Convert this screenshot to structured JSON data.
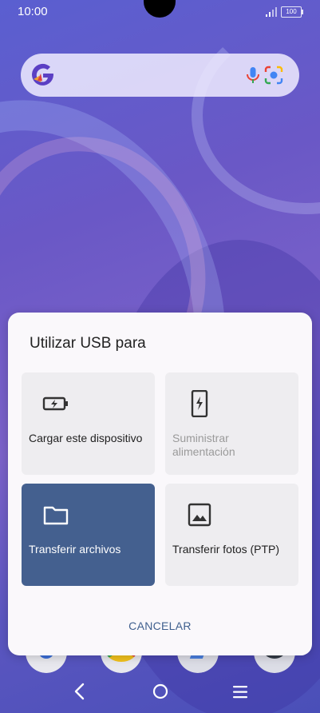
{
  "status_bar": {
    "time": "10:00",
    "battery_level": "100"
  },
  "search_widget": {
    "logo_icon": "google-g-icon",
    "mic_icon": "microphone-icon",
    "lens_icon": "camera-lens-icon"
  },
  "dialog": {
    "title": "Utilizar USB para",
    "options": [
      {
        "label": "Cargar este dispositivo",
        "icon": "battery-charging-icon",
        "state": "normal"
      },
      {
        "label": "Suministrar alimentación",
        "icon": "phone-charging-icon",
        "state": "disabled"
      },
      {
        "label": "Transferir archivos",
        "icon": "folder-icon",
        "state": "selected"
      },
      {
        "label": "Transferir fotos (PTP)",
        "icon": "image-icon",
        "state": "normal"
      }
    ],
    "cancel_label": "CANCELAR"
  },
  "colors": {
    "selected_option": "#44608f",
    "accent_text": "#3f5f8e",
    "dialog_background": "#faf8fb",
    "option_background": "#eeedf0"
  },
  "nav_bar": {
    "back_icon": "back-chevron-icon",
    "home_icon": "home-circle-icon",
    "menu_icon": "menu-lines-icon"
  }
}
